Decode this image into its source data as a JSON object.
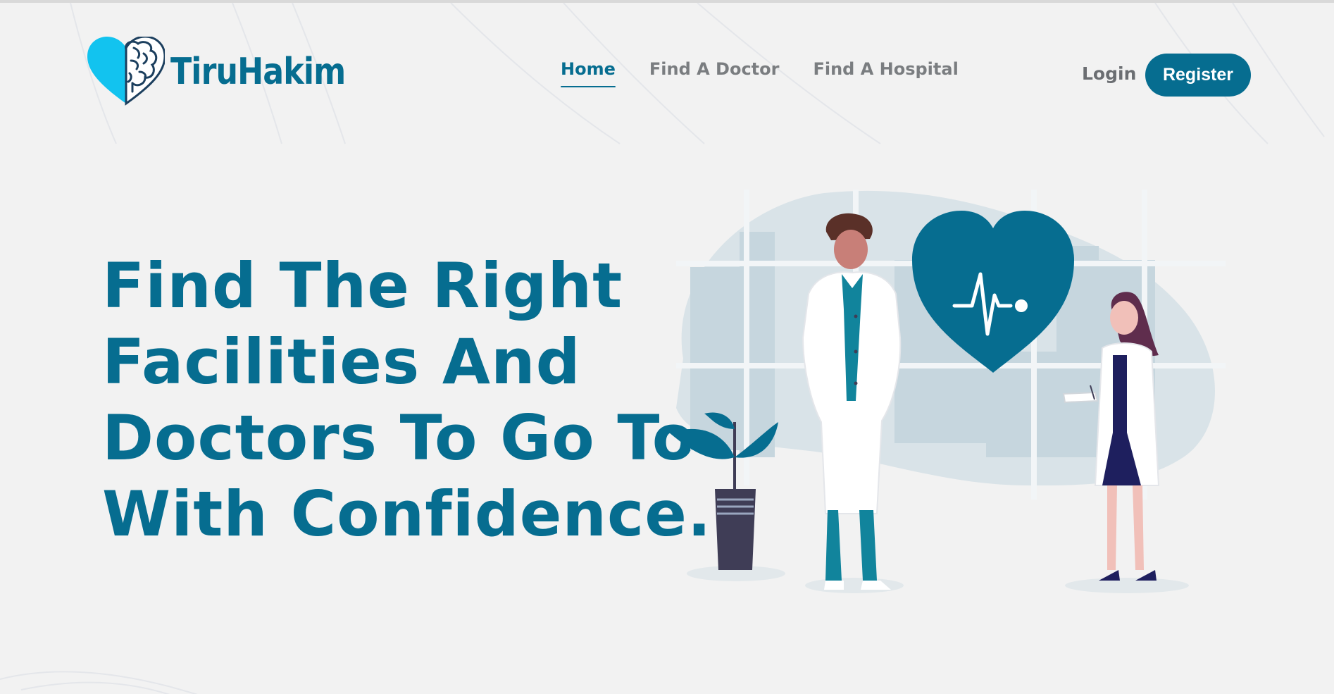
{
  "brand": {
    "name": "TiruHakim",
    "colors": {
      "primary": "#066d90",
      "accent": "#12c3ef",
      "background": "#f2f2f2"
    }
  },
  "nav": {
    "items": [
      {
        "label": "Home",
        "active": true
      },
      {
        "label": "Find A Doctor",
        "active": false
      },
      {
        "label": "Find A Hospital",
        "active": false
      }
    ]
  },
  "auth": {
    "login_label": "Login",
    "register_label": "Register"
  },
  "hero": {
    "title_lines": [
      "Find The Right",
      "Facilities And",
      "Doctors To Go To",
      "With Confidence."
    ]
  },
  "icons": {
    "logo": "heart-brain-icon",
    "illustration": "doctors-heartbeat-illustration"
  }
}
